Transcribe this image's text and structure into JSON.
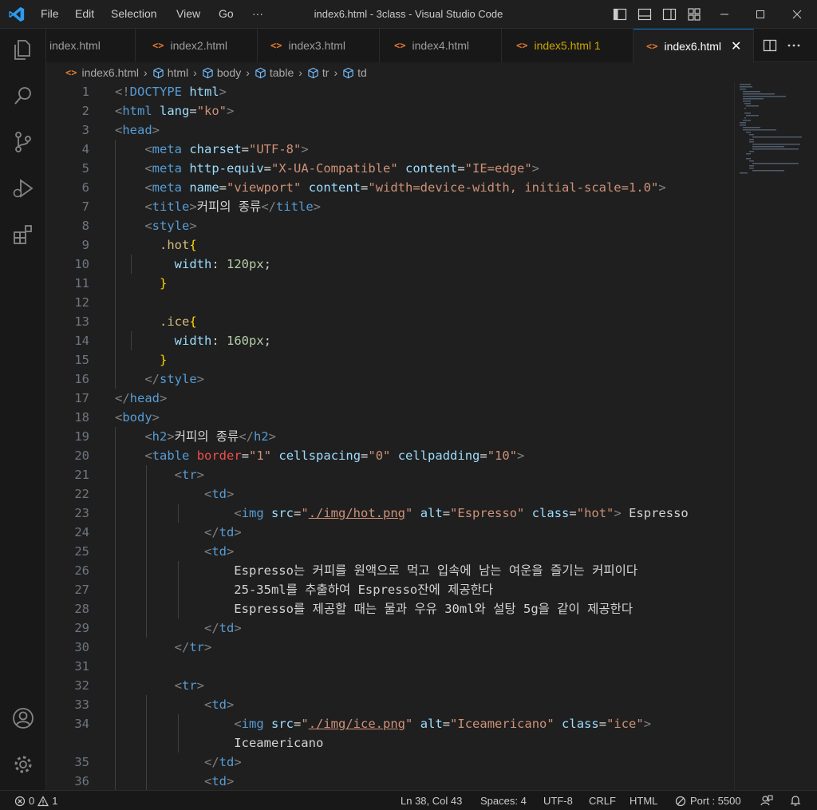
{
  "titlebar": {
    "menu": [
      "File",
      "Edit",
      "Selection",
      "View",
      "Go",
      "···"
    ],
    "title": "index6.html - 3class - Visual Studio Code"
  },
  "tabs": [
    {
      "label": "index.html",
      "state": "normal"
    },
    {
      "label": "index2.html",
      "state": "normal"
    },
    {
      "label": "index3.html",
      "state": "normal"
    },
    {
      "label": "index4.html",
      "state": "normal"
    },
    {
      "label": "index5.html 1",
      "state": "modified"
    },
    {
      "label": "index6.html",
      "state": "active"
    }
  ],
  "breadcrumb": [
    "index6.html",
    "html",
    "body",
    "table",
    "tr",
    "td"
  ],
  "code": [
    {
      "n": "1",
      "tokens": [
        [
          "punc",
          "<!"
        ],
        [
          "tag",
          "DOCTYPE"
        ],
        [
          "text",
          " "
        ],
        [
          "attr",
          "html"
        ],
        [
          "punc",
          ">"
        ]
      ]
    },
    {
      "n": "2",
      "tokens": [
        [
          "punc",
          "<"
        ],
        [
          "tag",
          "html"
        ],
        [
          "text",
          " "
        ],
        [
          "attr",
          "lang"
        ],
        [
          "text",
          "="
        ],
        [
          "str",
          "\"ko\""
        ],
        [
          "punc",
          ">"
        ]
      ]
    },
    {
      "n": "3",
      "tokens": [
        [
          "punc",
          "<"
        ],
        [
          "tag",
          "head"
        ],
        [
          "punc",
          ">"
        ]
      ]
    },
    {
      "n": "4",
      "tokens": [
        [
          "text",
          "    "
        ],
        [
          "punc",
          "<"
        ],
        [
          "tag",
          "meta"
        ],
        [
          "text",
          " "
        ],
        [
          "attr",
          "charset"
        ],
        [
          "text",
          "="
        ],
        [
          "str",
          "\"UTF-8\""
        ],
        [
          "punc",
          ">"
        ]
      ]
    },
    {
      "n": "5",
      "tokens": [
        [
          "text",
          "    "
        ],
        [
          "punc",
          "<"
        ],
        [
          "tag",
          "meta"
        ],
        [
          "text",
          " "
        ],
        [
          "attr",
          "http-equiv"
        ],
        [
          "text",
          "="
        ],
        [
          "str",
          "\"X-UA-Compatible\""
        ],
        [
          "text",
          " "
        ],
        [
          "attr",
          "content"
        ],
        [
          "text",
          "="
        ],
        [
          "str",
          "\"IE=edge\""
        ],
        [
          "punc",
          ">"
        ]
      ]
    },
    {
      "n": "6",
      "tokens": [
        [
          "text",
          "    "
        ],
        [
          "punc",
          "<"
        ],
        [
          "tag",
          "meta"
        ],
        [
          "text",
          " "
        ],
        [
          "attr",
          "name"
        ],
        [
          "text",
          "="
        ],
        [
          "str",
          "\"viewport\""
        ],
        [
          "text",
          " "
        ],
        [
          "attr",
          "content"
        ],
        [
          "text",
          "="
        ],
        [
          "str",
          "\"width=device-width, initial-scale=1.0\""
        ],
        [
          "punc",
          ">"
        ]
      ]
    },
    {
      "n": "7",
      "tokens": [
        [
          "text",
          "    "
        ],
        [
          "punc",
          "<"
        ],
        [
          "tag",
          "title"
        ],
        [
          "punc",
          ">"
        ],
        [
          "text",
          "커피의 종류"
        ],
        [
          "punc",
          "</"
        ],
        [
          "tag",
          "title"
        ],
        [
          "punc",
          ">"
        ]
      ]
    },
    {
      "n": "8",
      "tokens": [
        [
          "text",
          "    "
        ],
        [
          "punc",
          "<"
        ],
        [
          "tag",
          "style"
        ],
        [
          "punc",
          ">"
        ]
      ]
    },
    {
      "n": "9",
      "tokens": [
        [
          "text",
          "      "
        ],
        [
          "sel",
          ".hot"
        ],
        [
          "brace",
          "{"
        ]
      ]
    },
    {
      "n": "10",
      "tokens": [
        [
          "text",
          "        "
        ],
        [
          "prop",
          "width"
        ],
        [
          "text",
          ": "
        ],
        [
          "num",
          "120px"
        ],
        [
          "text",
          ";"
        ]
      ]
    },
    {
      "n": "11",
      "tokens": [
        [
          "text",
          "      "
        ],
        [
          "brace",
          "}"
        ]
      ]
    },
    {
      "n": "12",
      "tokens": []
    },
    {
      "n": "13",
      "tokens": [
        [
          "text",
          "      "
        ],
        [
          "sel",
          ".ice"
        ],
        [
          "brace",
          "{"
        ]
      ]
    },
    {
      "n": "14",
      "tokens": [
        [
          "text",
          "        "
        ],
        [
          "prop",
          "width"
        ],
        [
          "text",
          ": "
        ],
        [
          "num",
          "160px"
        ],
        [
          "text",
          ";"
        ]
      ]
    },
    {
      "n": "15",
      "tokens": [
        [
          "text",
          "      "
        ],
        [
          "brace",
          "}"
        ]
      ]
    },
    {
      "n": "16",
      "tokens": [
        [
          "text",
          "    "
        ],
        [
          "punc",
          "</"
        ],
        [
          "tag",
          "style"
        ],
        [
          "punc",
          ">"
        ]
      ]
    },
    {
      "n": "17",
      "tokens": [
        [
          "punc",
          "</"
        ],
        [
          "tag",
          "head"
        ],
        [
          "punc",
          ">"
        ]
      ]
    },
    {
      "n": "18",
      "tokens": [
        [
          "punc",
          "<"
        ],
        [
          "tag",
          "body"
        ],
        [
          "punc",
          ">"
        ]
      ]
    },
    {
      "n": "19",
      "tokens": [
        [
          "text",
          "    "
        ],
        [
          "punc",
          "<"
        ],
        [
          "tag",
          "h2"
        ],
        [
          "punc",
          ">"
        ],
        [
          "text",
          "커피의 종류"
        ],
        [
          "punc",
          "</"
        ],
        [
          "tag",
          "h2"
        ],
        [
          "punc",
          ">"
        ]
      ]
    },
    {
      "n": "20",
      "tokens": [
        [
          "text",
          "    "
        ],
        [
          "punc",
          "<"
        ],
        [
          "tag",
          "table"
        ],
        [
          "text",
          " "
        ],
        [
          "red",
          "border"
        ],
        [
          "text",
          "="
        ],
        [
          "str",
          "\"1\""
        ],
        [
          "text",
          " "
        ],
        [
          "attr",
          "cellspacing"
        ],
        [
          "text",
          "="
        ],
        [
          "str",
          "\"0\""
        ],
        [
          "text",
          " "
        ],
        [
          "attr",
          "cellpadding"
        ],
        [
          "text",
          "="
        ],
        [
          "str",
          "\"10\""
        ],
        [
          "punc",
          ">"
        ]
      ]
    },
    {
      "n": "21",
      "tokens": [
        [
          "text",
          "        "
        ],
        [
          "punc",
          "<"
        ],
        [
          "tag",
          "tr"
        ],
        [
          "punc",
          ">"
        ]
      ]
    },
    {
      "n": "22",
      "tokens": [
        [
          "text",
          "            "
        ],
        [
          "punc",
          "<"
        ],
        [
          "tag",
          "td"
        ],
        [
          "punc",
          ">"
        ]
      ]
    },
    {
      "n": "23",
      "tokens": [
        [
          "text",
          "                "
        ],
        [
          "punc",
          "<"
        ],
        [
          "tag",
          "img"
        ],
        [
          "text",
          " "
        ],
        [
          "attr",
          "src"
        ],
        [
          "text",
          "="
        ],
        [
          "str",
          "\""
        ],
        [
          "strlink",
          "./img/hot.png"
        ],
        [
          "str",
          "\""
        ],
        [
          "text",
          " "
        ],
        [
          "attr",
          "alt"
        ],
        [
          "text",
          "="
        ],
        [
          "str",
          "\"Espresso\""
        ],
        [
          "text",
          " "
        ],
        [
          "attr",
          "class"
        ],
        [
          "text",
          "="
        ],
        [
          "str",
          "\"hot\""
        ],
        [
          "punc",
          ">"
        ],
        [
          "text",
          " Espresso"
        ]
      ]
    },
    {
      "n": "24",
      "tokens": [
        [
          "text",
          "            "
        ],
        [
          "punc",
          "</"
        ],
        [
          "tag",
          "td"
        ],
        [
          "punc",
          ">"
        ]
      ]
    },
    {
      "n": "25",
      "tokens": [
        [
          "text",
          "            "
        ],
        [
          "punc",
          "<"
        ],
        [
          "tag",
          "td"
        ],
        [
          "punc",
          ">"
        ]
      ]
    },
    {
      "n": "26",
      "tokens": [
        [
          "text",
          "                Espresso는 커피를 원액으로 먹고 입속에 남는 여운을 즐기는 커피이다"
        ]
      ]
    },
    {
      "n": "27",
      "tokens": [
        [
          "text",
          "                25-35ml를 추출하여 Espresso잔에 제공한다"
        ]
      ]
    },
    {
      "n": "28",
      "tokens": [
        [
          "text",
          "                Espresso를 제공할 때는 물과 우유 30ml와 설탕 5g을 같이 제공한다"
        ]
      ]
    },
    {
      "n": "29",
      "tokens": [
        [
          "text",
          "            "
        ],
        [
          "punc",
          "</"
        ],
        [
          "tag",
          "td"
        ],
        [
          "punc",
          ">"
        ]
      ]
    },
    {
      "n": "30",
      "tokens": [
        [
          "text",
          "        "
        ],
        [
          "punc",
          "</"
        ],
        [
          "tag",
          "tr"
        ],
        [
          "punc",
          ">"
        ]
      ]
    },
    {
      "n": "31",
      "tokens": []
    },
    {
      "n": "32",
      "tokens": [
        [
          "text",
          "        "
        ],
        [
          "punc",
          "<"
        ],
        [
          "tag",
          "tr"
        ],
        [
          "punc",
          ">"
        ]
      ]
    },
    {
      "n": "33",
      "tokens": [
        [
          "text",
          "            "
        ],
        [
          "punc",
          "<"
        ],
        [
          "tag",
          "td"
        ],
        [
          "punc",
          ">"
        ]
      ]
    },
    {
      "n": "34",
      "tokens": [
        [
          "text",
          "                "
        ],
        [
          "punc",
          "<"
        ],
        [
          "tag",
          "img"
        ],
        [
          "text",
          " "
        ],
        [
          "attr",
          "src"
        ],
        [
          "text",
          "="
        ],
        [
          "str",
          "\""
        ],
        [
          "strlink",
          "./img/ice.png"
        ],
        [
          "str",
          "\""
        ],
        [
          "text",
          " "
        ],
        [
          "attr",
          "alt"
        ],
        [
          "text",
          "="
        ],
        [
          "str",
          "\"Iceamericano\""
        ],
        [
          "text",
          " "
        ],
        [
          "attr",
          "class"
        ],
        [
          "text",
          "="
        ],
        [
          "str",
          "\"ice\""
        ],
        [
          "punc",
          ">"
        ]
      ]
    },
    {
      "n": "",
      "tokens": [
        [
          "text",
          "                Iceamericano"
        ]
      ]
    },
    {
      "n": "35",
      "tokens": [
        [
          "text",
          "            "
        ],
        [
          "punc",
          "</"
        ],
        [
          "tag",
          "td"
        ],
        [
          "punc",
          ">"
        ]
      ]
    },
    {
      "n": "36",
      "tokens": [
        [
          "text",
          "            "
        ],
        [
          "punc",
          "<"
        ],
        [
          "tag",
          "td"
        ],
        [
          "punc",
          ">"
        ]
      ]
    }
  ],
  "statusbar": {
    "errors": "0",
    "warnings": "1",
    "position": "Ln 38, Col 43",
    "spaces": "Spaces: 4",
    "encoding": "UTF-8",
    "eol": "CRLF",
    "language": "HTML",
    "port": "Port : 5500"
  },
  "colors": {
    "accent": "#0078d4",
    "tag": "#569cd6",
    "attr": "#9cdcfe",
    "string": "#ce9178",
    "modified_tab": "#cca700"
  }
}
